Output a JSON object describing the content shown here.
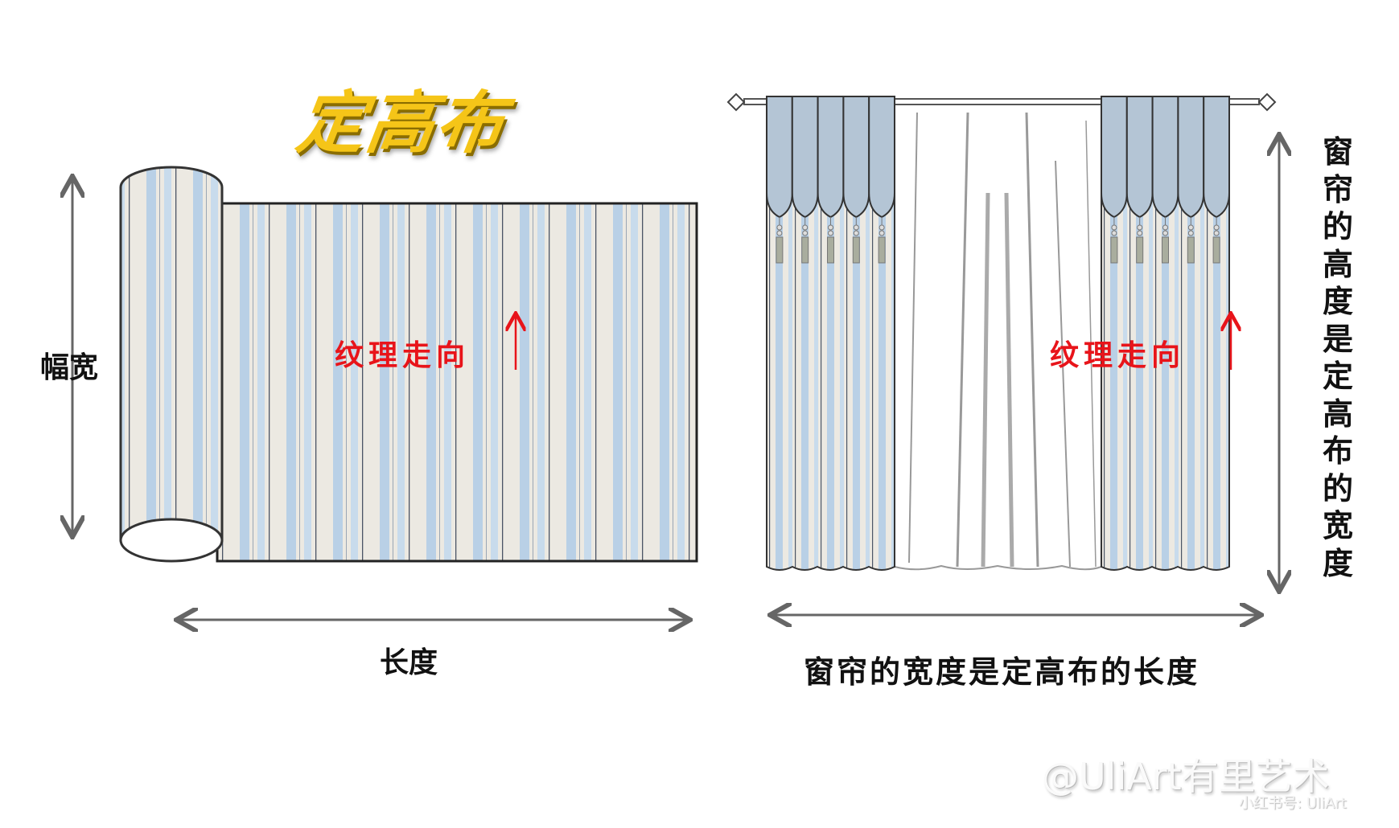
{
  "title": "定高布",
  "roll": {
    "width_label": "幅宽",
    "length_label": "长度",
    "texture_label": "纹理走向"
  },
  "curtain": {
    "texture_label": "纹理走向",
    "height_caption": "窗帘的高度是定高布的宽度",
    "width_caption": "窗帘的宽度是定高布的长度"
  },
  "watermark": {
    "main": "@UliArt有里艺术",
    "sub": "小红书号: UliArt"
  },
  "colors": {
    "title": "#f5c518",
    "texture_arrow": "#e8141a",
    "stripe_blue": "#b9d0e6",
    "stripe_cream": "#ece9e2",
    "valance": "#b4c5d5",
    "dimension_arrow": "#666666"
  }
}
